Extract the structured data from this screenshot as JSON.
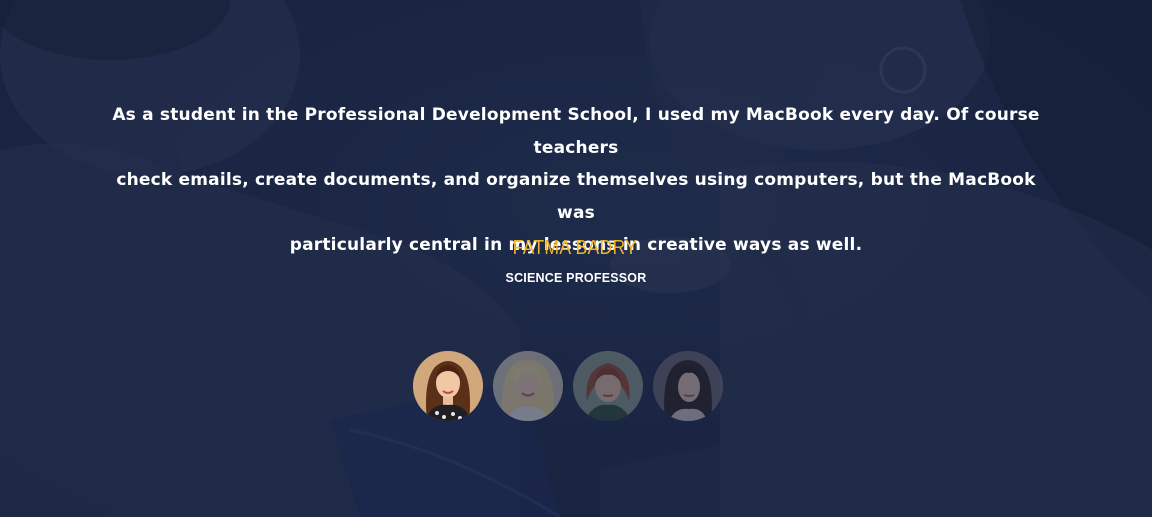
{
  "testimonial": {
    "quote_lines": [
      "As a student in the Professional Development School, I used my MacBook every day. Of course teachers",
      "check emails, create documents, and organize themselves using computers, but the MacBook was",
      "particularly central in my lessons in creative ways as well."
    ],
    "author_name": "FATMA BADRY",
    "author_role": "SCIENCE PROFESSOR"
  },
  "avatars": [
    {
      "icon": "avatar-portrait-brunette-icon",
      "active": true
    },
    {
      "icon": "avatar-portrait-blonde-icon",
      "active": false
    },
    {
      "icon": "avatar-portrait-redhead-icon",
      "active": false
    },
    {
      "icon": "avatar-portrait-dark-hair-icon",
      "active": false
    }
  ],
  "colors": {
    "background": "#1e2a4a",
    "accent": "#f0b429",
    "text": "#ffffff"
  }
}
